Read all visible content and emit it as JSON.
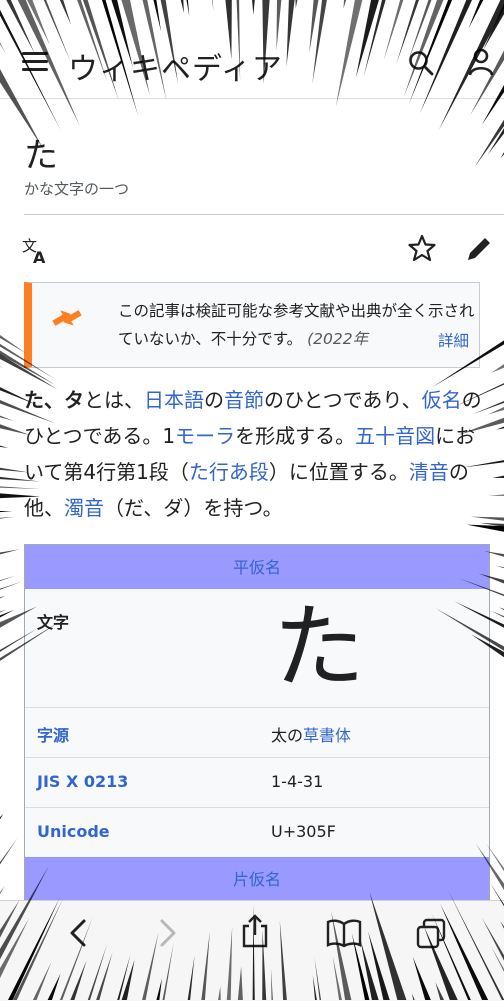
{
  "header": {
    "wordmark": "ウィキペディア",
    "menu_icon": "hamburger-menu-icon",
    "search_icon": "search-icon",
    "user_icon": "user-icon"
  },
  "article": {
    "title": "た",
    "subtitle": "かな文字の一つ",
    "actions": [
      "translate-icon",
      "star-icon",
      "edit-icon"
    ]
  },
  "notice": {
    "text": "この記事は検証可能な参考文献や出典が全く示されていないか、不十分です。",
    "date": "(2022年",
    "link": "詳細",
    "accent_color": "#fc7f21"
  },
  "lead": {
    "w1": "た、タ",
    "t1": "とは、",
    "l1": "日本語",
    "t2": "の",
    "l2": "音節",
    "t3": "のひとつであり、",
    "l3": "仮名",
    "t4": "のひとつである。1",
    "l4": "モーラ",
    "t5": "を形成する。",
    "l5": "五十音図",
    "t6": "において第4行第1段（",
    "l6": "た行あ段",
    "t7": "）に位置する。",
    "l7": "清音",
    "t8": "の他、",
    "l8": "濁音",
    "t9": "（だ、ダ）を持つ。"
  },
  "infobox": {
    "header": "平仮名",
    "rows": [
      {
        "label": "文字",
        "value": "た"
      },
      {
        "label": "字源",
        "value_prefix": "太の",
        "value_link": "草書体"
      },
      {
        "label": "JIS X 0213",
        "value": "1-4-31"
      },
      {
        "label": "Unicode",
        "value": "U+305F"
      }
    ],
    "header2": "片仮名",
    "header_color": "#9999ff"
  },
  "browser_toolbar": {
    "icons": [
      "back-icon",
      "forward-icon",
      "share-icon",
      "bookmarks-icon",
      "tabs-icon"
    ]
  },
  "colors": {
    "link": "#3366cc",
    "text": "#202122",
    "muted": "#54595d"
  }
}
